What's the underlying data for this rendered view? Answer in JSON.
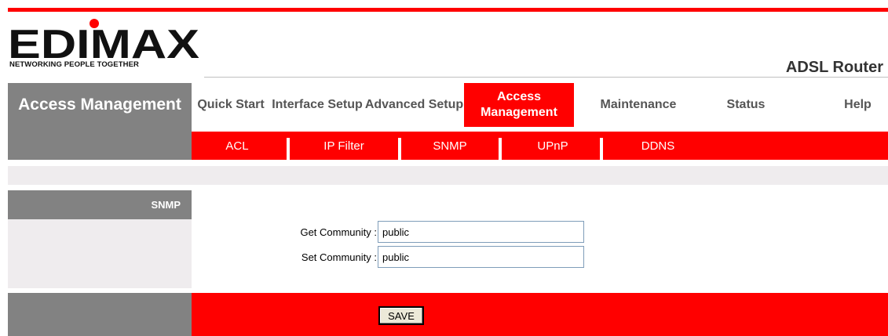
{
  "brand": {
    "logo_text": "EDIMAX",
    "tagline": "NETWORKING PEOPLE TOGETHER",
    "product": "ADSL Router",
    "accent": "#ff0000",
    "gray": "#828282"
  },
  "sidebar": {
    "title": "Access Management"
  },
  "nav": {
    "items": [
      {
        "label": "Quick Start"
      },
      {
        "label": "Interface Setup"
      },
      {
        "label": "Advanced Setup"
      },
      {
        "label": "Access Management",
        "active": true
      },
      {
        "label": "Maintenance"
      },
      {
        "label": "Status"
      },
      {
        "label": "Help"
      }
    ]
  },
  "subnav": {
    "items": [
      {
        "label": "ACL"
      },
      {
        "label": "IP Filter"
      },
      {
        "label": "SNMP"
      },
      {
        "label": "UPnP"
      },
      {
        "label": "DDNS"
      }
    ]
  },
  "section": {
    "label": "SNMP"
  },
  "form": {
    "get_label": "Get Community :",
    "get_value": "public",
    "set_label": "Set Community :",
    "set_value": "public"
  },
  "actions": {
    "save_label": "SAVE"
  }
}
